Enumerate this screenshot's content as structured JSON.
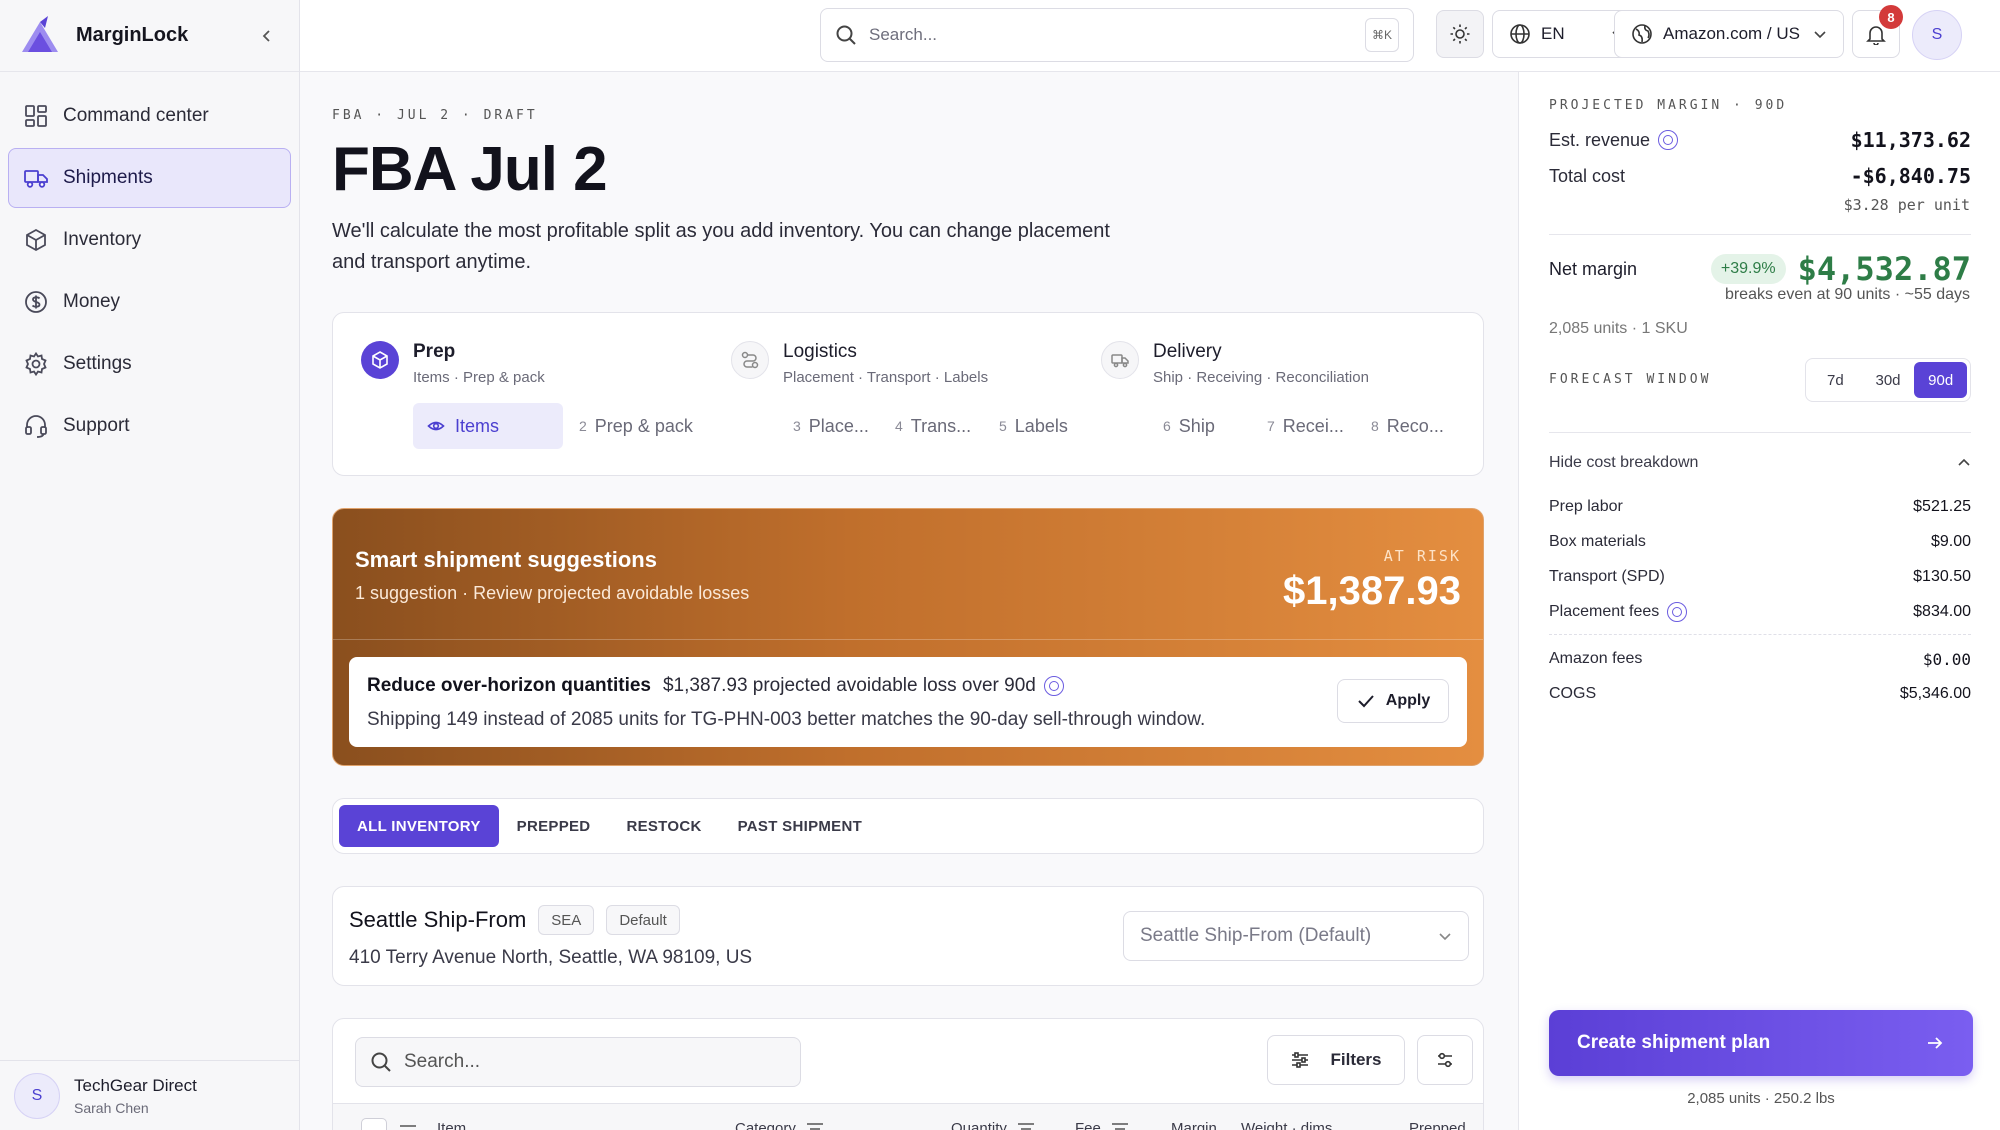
{
  "brand": {
    "name": "MarginLock"
  },
  "nav": {
    "items": [
      {
        "label": "Command center",
        "icon": "grid-icon"
      },
      {
        "label": "Shipments",
        "icon": "truck-icon",
        "active": true
      },
      {
        "label": "Inventory",
        "icon": "box-icon"
      },
      {
        "label": "Money",
        "icon": "dollar-icon"
      },
      {
        "label": "Settings",
        "icon": "gear-icon"
      },
      {
        "label": "Support",
        "icon": "headset-icon"
      }
    ]
  },
  "account": {
    "initial": "S",
    "org": "TechGear Direct",
    "user": "Sarah Chen"
  },
  "topbar": {
    "search_placeholder": "Search...",
    "shortcut": "⌘K",
    "language": "EN",
    "marketplace": "Amazon.com / US",
    "notifications": "8",
    "avatar_initial": "S"
  },
  "page": {
    "breadcrumb": "FBA · JUL 2 · DRAFT",
    "title": "FBA Jul 2",
    "description": "We'll calculate the most profitable split as you add inventory. You can change placement and transport anytime."
  },
  "stages": [
    {
      "title": "Prep",
      "subtitle": "Items · Prep & pack"
    },
    {
      "title": "Logistics",
      "subtitle": "Placement · Transport · Labels"
    },
    {
      "title": "Delivery",
      "subtitle": "Ship · Receiving · Reconciliation"
    }
  ],
  "substeps": [
    {
      "num": "",
      "label": "Items"
    },
    {
      "num": "2",
      "label": "Prep & pack"
    },
    {
      "num": "3",
      "label": "Place..."
    },
    {
      "num": "4",
      "label": "Trans..."
    },
    {
      "num": "5",
      "label": "Labels"
    },
    {
      "num": "6",
      "label": "Ship"
    },
    {
      "num": "7",
      "label": "Recei..."
    },
    {
      "num": "8",
      "label": "Reco..."
    }
  ],
  "suggestions": {
    "title": "Smart shipment suggestions",
    "subtitle": "1 suggestion · Review projected avoidable losses",
    "risk_label": "AT RISK",
    "risk_value": "$1,387.93",
    "item": {
      "title": "Reduce over-horizon quantities",
      "amount_text": "$1,387.93 projected avoidable loss over 90d",
      "detail": "Shipping 149 instead of 2085 units for TG-PHN-003 better matches the 90-day sell-through window.",
      "apply_label": "Apply"
    }
  },
  "filter_tabs": [
    "ALL INVENTORY",
    "PREPPED",
    "RESTOCK",
    "PAST SHIPMENT"
  ],
  "ship_from": {
    "name": "Seattle Ship-From",
    "chip_code": "SEA",
    "chip_default": "Default",
    "address": "410 Terry Avenue North, Seattle, WA 98109, US",
    "select_value": "Seattle Ship-From (Default)"
  },
  "table": {
    "search_placeholder": "Search...",
    "filters_label": "Filters",
    "columns": [
      "Item",
      "Category",
      "Quantity",
      "Fee",
      "Margin",
      "Weight · dims",
      "Prepped"
    ]
  },
  "summary": {
    "section_label": "PROJECTED MARGIN · 90D",
    "est_revenue_label": "Est. revenue",
    "est_revenue": "$11,373.62",
    "total_cost_label": "Total cost",
    "total_cost": "-$6,840.75",
    "per_unit": "$3.28 per unit",
    "net_margin_label": "Net margin",
    "net_margin_pct": "+39.9%",
    "net_margin": "$4,532.87",
    "breakeven": "breaks even at 90 units · ~55 days",
    "units_sku": "2,085 units · 1 SKU",
    "forecast_label": "FORECAST WINDOW",
    "forecast_options": [
      "7d",
      "30d",
      "90d"
    ],
    "forecast_selected": "90d",
    "breakdown_toggle": "Hide cost breakdown",
    "costs": [
      {
        "label": "Prep labor",
        "value": "$521.25"
      },
      {
        "label": "Box materials",
        "value": "$9.00"
      },
      {
        "label": "Transport (SPD)",
        "value": "$130.50"
      },
      {
        "label": "Placement fees",
        "value": "$834.00"
      }
    ],
    "other_costs": [
      {
        "label": "Amazon fees",
        "value": "$0.00"
      },
      {
        "label": "COGS",
        "value": "$5,346.00"
      }
    ],
    "create_label": "Create shipment plan",
    "create_footer": "2,085 units · 250.2 lbs"
  },
  "colors": {
    "accent": "#5a43d6",
    "positive": "#2e7d47",
    "risk_gradient_start": "#8a4f1e",
    "risk_gradient_end": "#e48e40"
  }
}
